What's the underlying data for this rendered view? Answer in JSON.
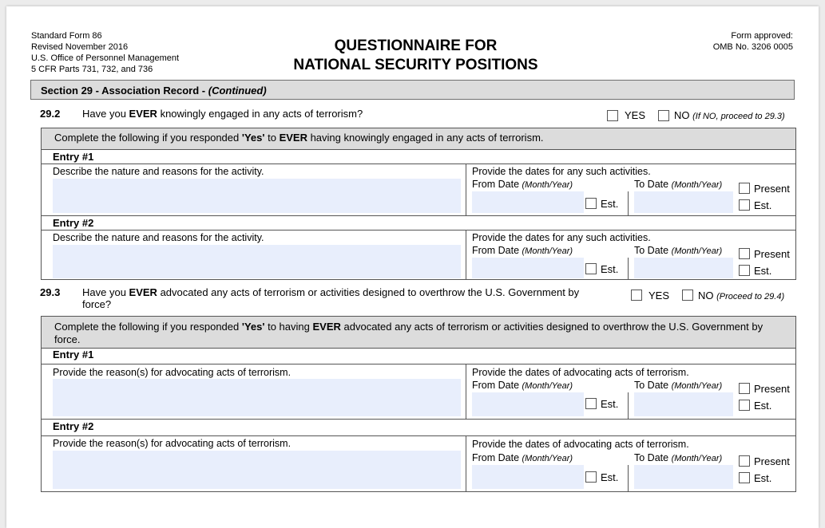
{
  "header": {
    "left": [
      "Standard Form 86",
      "Revised November 2016",
      "U.S. Office of Personnel Management",
      "5 CFR Parts 731, 732, and 736"
    ],
    "title_line1": "QUESTIONNAIRE FOR",
    "title_line2": "NATIONAL SECURITY POSITIONS",
    "right": [
      "Form approved:",
      "OMB No. 3206 0005"
    ]
  },
  "section": {
    "title": "Section 29 - Association Record - ",
    "title_italic": "(Continued)"
  },
  "q292": {
    "number": "29.2",
    "text_pre": "Have you ",
    "text_bold": "EVER",
    "text_post": " knowingly engaged in any acts of terrorism?",
    "yes": "YES",
    "no": "NO",
    "no_note": "(If NO, proceed to 29.3)",
    "instruction_pre": "Complete the following if you responded ",
    "instruction_bold1": "'Yes'",
    "instruction_mid": " to ",
    "instruction_bold2": "EVER",
    "instruction_post": " having knowingly engaged in any acts of terrorism.",
    "entries": [
      {
        "title": "Entry #1",
        "desc_label": "Describe the nature and reasons for the activity.",
        "dates_label": "Provide the dates for any such activities."
      },
      {
        "title": "Entry #2",
        "desc_label": "Describe the nature and reasons for the activity.",
        "dates_label": "Provide the dates for any such activities."
      }
    ]
  },
  "q293": {
    "number": "29.3",
    "text_pre": "Have you ",
    "text_bold": "EVER",
    "text_post": " advocated any acts of terrorism or activities designed to overthrow the U.S. Government by",
    "text_line2": "force?",
    "yes": "YES",
    "no": "NO",
    "no_note": "(Proceed to 29.4)",
    "instruction_pre": "Complete the following if you responded ",
    "instruction_bold1": "'Yes'",
    "instruction_mid": " to having ",
    "instruction_bold2": "EVER",
    "instruction_post": " advocated any acts of terrorism or activities designed to overthrow the U.S. Government by",
    "instruction_line2": "force.",
    "entries": [
      {
        "title": "Entry #1",
        "desc_label": "Provide the reason(s) for advocating acts of terrorism.",
        "dates_label": "Provide the dates of advocating acts of terrorism."
      },
      {
        "title": "Entry #2",
        "desc_label": "Provide the reason(s) for advocating acts of terrorism.",
        "dates_label": "Provide the dates of advocating acts of terrorism."
      }
    ]
  },
  "dates": {
    "from": "From Date ",
    "to": "To Date ",
    "month_year": "(Month/Year)",
    "est": "Est.",
    "present": "Present"
  }
}
